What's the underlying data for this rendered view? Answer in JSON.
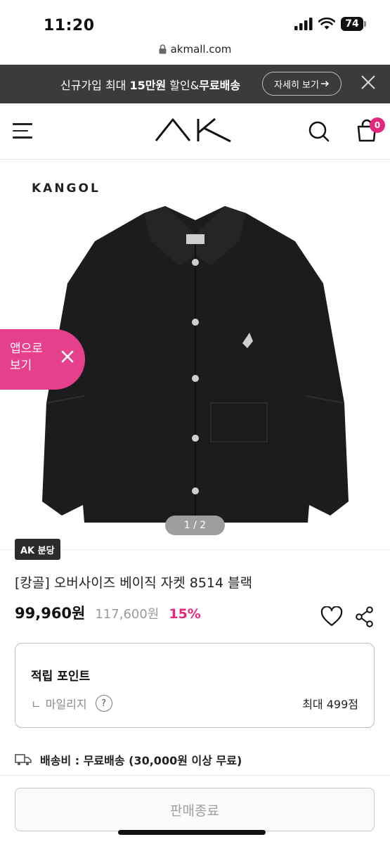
{
  "status_bar": {
    "time": "11:20",
    "battery": "74"
  },
  "browser": {
    "url": "akmall.com"
  },
  "promo": {
    "text_prefix": "신규가입 최대 ",
    "text_bold": "15만원",
    "text_mid": " 할인&",
    "text_suffix": "무료배송",
    "more_label": "자세히 보기"
  },
  "header": {
    "logo": "AK",
    "cart_count": "0"
  },
  "product": {
    "brand_mark": "KANGOL",
    "app_banner": "앱으로\n보기",
    "app_banner_line1": "앱으로",
    "app_banner_line2": "보기",
    "pager": "1 / 2",
    "store_badge": "AK 분당",
    "title": "[캉골] 오버사이즈 베이직 자켓 8514 블랙",
    "price": "99,960원",
    "original_price": "117,600원",
    "discount": "15%"
  },
  "points": {
    "heading": "적립 포인트",
    "row_prefix": "ㄴ",
    "row_label": "마일리지",
    "help": "?",
    "row_value": "최대 499점"
  },
  "shipping": {
    "text": "배송비 : 무료배송 (30,000원 이상 무료)"
  },
  "cta": {
    "label": "판매종료"
  },
  "colors": {
    "accent_pink": "#e4267d",
    "banner_bg": "#3b3b3b",
    "app_pill": "#e6408c"
  }
}
